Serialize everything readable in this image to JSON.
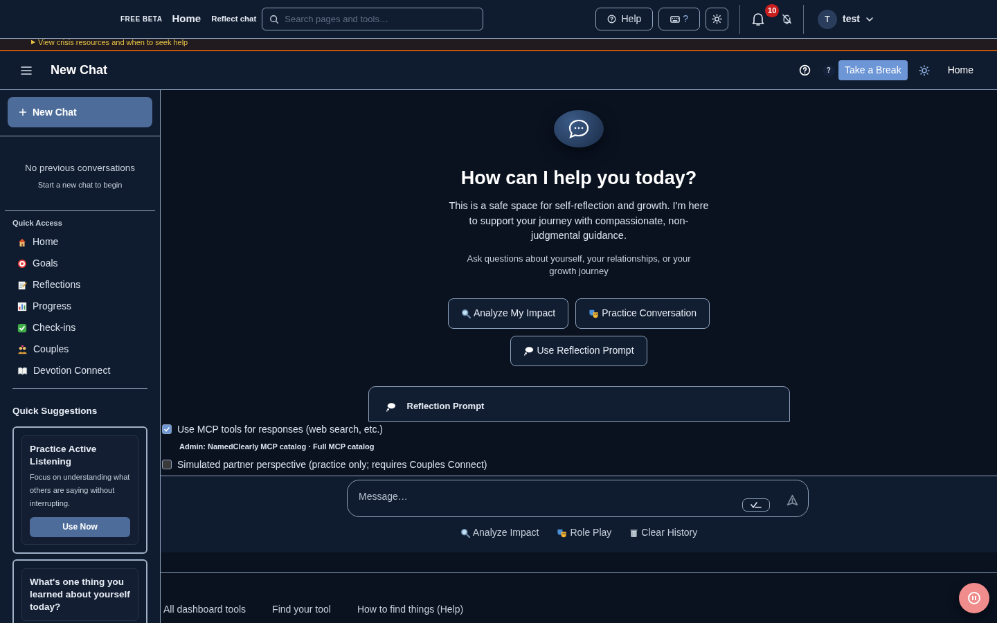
{
  "topbar": {
    "badge": "FREE BETA",
    "home": "Home",
    "section": "Reflect chat",
    "search": {
      "placeholder": "Search pages and tools…"
    },
    "help": "Help",
    "shortcuts": "?",
    "notifications": "10",
    "user": {
      "initial": "T",
      "name": "test"
    }
  },
  "banner": {
    "marker": "▶",
    "link": "View crisis resources and when to seek help"
  },
  "header": {
    "title": "New Chat",
    "hint": "?",
    "break_button": "Take a Break",
    "home": "Home"
  },
  "sidebar": {
    "new_chat": "New Chat",
    "empty_title": "No previous conversations",
    "empty_hint": "Start a new chat to begin",
    "quick_access_title": "Quick Access",
    "quick_access": [
      {
        "kind": "house",
        "label": "Home"
      },
      {
        "kind": "target",
        "label": "Goals"
      },
      {
        "kind": "memo",
        "label": "Reflections"
      },
      {
        "kind": "chart",
        "label": "Progress"
      },
      {
        "kind": "check",
        "label": "Check-ins"
      },
      {
        "kind": "couple",
        "label": "Couples"
      },
      {
        "kind": "book",
        "label": "Devotion Connect"
      }
    ],
    "suggestions_title": "Quick Suggestions",
    "suggestions": [
      {
        "title": "Practice Active Listening",
        "text": "Focus on understanding what others are saying without interrupting.",
        "action": "Use Now"
      },
      {
        "title": "What's one thing you learned about yourself today?"
      }
    ]
  },
  "welcome": {
    "title": "How can I help you today?",
    "text": "This is a safe space for self-reflection and growth. I'm here to support your journey with compassionate, non-judgmental guidance.",
    "subtext": "Ask questions about yourself, your relationships, or your growth journey",
    "actions": [
      {
        "kind": "magnifier",
        "label": "Analyze My Impact"
      },
      {
        "kind": "masks",
        "label": "Practice Conversation"
      },
      {
        "kind": "thought",
        "label": "Use Reflection Prompt"
      }
    ],
    "prompt_card": {
      "title": "Reflection Prompt"
    }
  },
  "options": [
    {
      "kind": "checkbox",
      "label": "Use MCP tools for responses (web search, etc.)",
      "checked": true
    },
    {
      "kind": "note",
      "text": "Admin: NamedClearly MCP catalog · Full MCP catalog"
    },
    {
      "kind": "checkbox",
      "label": "Simulated partner perspective (practice only; requires Couples Connect)",
      "checked": false
    }
  ],
  "composer": {
    "placeholder": "Message…",
    "quick_actions": [
      {
        "kind": "magnifier",
        "label": "Analyze Impact"
      },
      {
        "kind": "masks",
        "label": "Role Play"
      },
      {
        "kind": "trash",
        "label": "Clear History"
      }
    ]
  },
  "footer": {
    "links": [
      "All dashboard tools",
      "Find your tool",
      "How to find things (Help)"
    ]
  }
}
